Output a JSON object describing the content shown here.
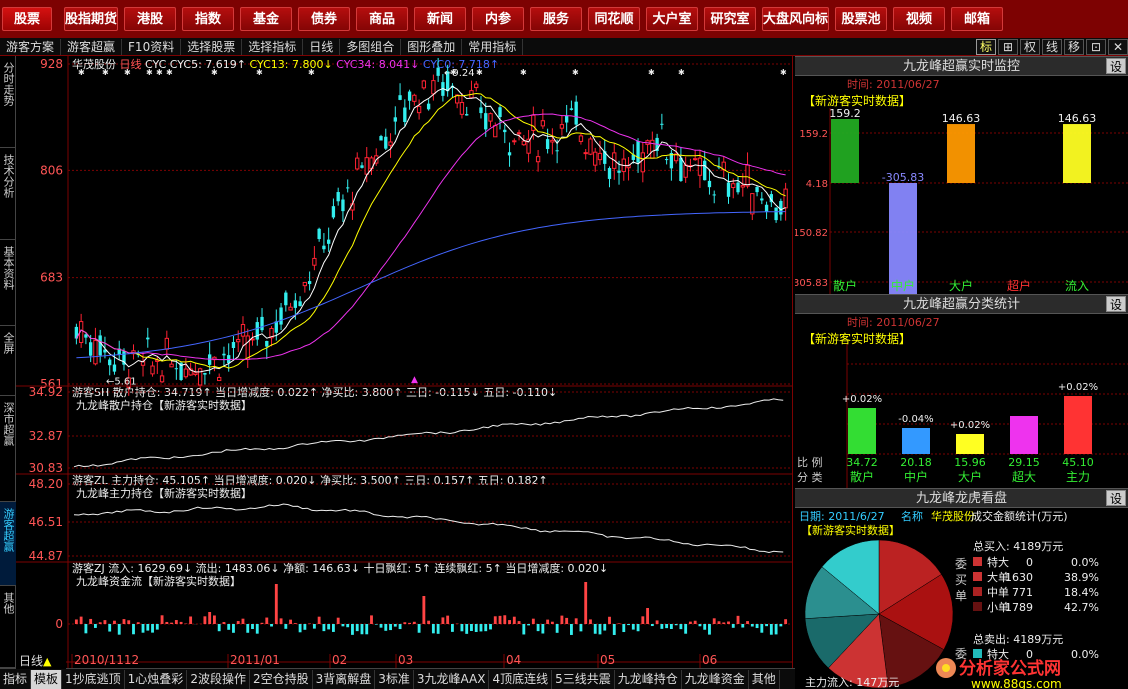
{
  "topmenu": [
    "股票",
    "股指期货",
    "港股",
    "指数",
    "基金",
    "债券",
    "商品",
    "新闻",
    "内参",
    "服务",
    "同花顺",
    "大户室",
    "研究室",
    "大盘风向标",
    "股票池",
    "视频",
    "邮箱"
  ],
  "toolbar": {
    "items": [
      "游客方案",
      "游客超赢",
      "F10资料",
      "选择股票",
      "选择指标",
      "日线",
      "多图组合",
      "图形叠加",
      "常用指标"
    ],
    "right_icons": [
      "标",
      "⊞",
      "权",
      "线",
      "移",
      "⊡",
      "✕"
    ]
  },
  "lefttabs": [
    "分时走势",
    "技术分析",
    "基本资料",
    "全屏",
    "深市超赢",
    "游客超赢",
    "其他"
  ],
  "bottombar": {
    "left_label": "日线",
    "tabs": [
      "指标",
      "模板",
      "1抄底逃顶",
      "1心烛叠彩",
      "2波段操作",
      "2空仓持股",
      "3背离解盘",
      "3标准",
      "3九龙峰AAX",
      "4顶底连线",
      "5三线共震",
      "九龙峰持仓",
      "九龙峰资金",
      "其他"
    ]
  },
  "main": {
    "stock": "华茂股份",
    "period": "日线",
    "indicator": "CYC",
    "cyc5": "CYC5: 7.619↑",
    "cyc13": "CYC13: 7.800↓",
    "cyc34": "CYC34: 8.041↓",
    "cyc0": "CYC0: 7.718↑",
    "high_label": "9.24",
    "low_label": "5.61",
    "y_ticks": [
      "928",
      "806",
      "683",
      "561"
    ],
    "date_labels": [
      "2010/1112",
      "2011/01",
      "02",
      "03",
      "04",
      "05",
      "06"
    ],
    "colors": {
      "up": "#f23",
      "down": "#3ee",
      "cyc5": "#fff",
      "cyc13": "#ff0",
      "cyc34": "#e3e",
      "cyc0": "#46f"
    }
  },
  "panel1": {
    "line1": "游客SH 散户持仓: 34.719↑ 当日增减度: 0.022↑ 净买比: 3.800↑ 三日: -0.115↓ 五日: -0.110↓",
    "line2": "九龙峰散户持仓【新游客实时数据】",
    "y_ticks": [
      "34.92",
      "32.87",
      "30.83"
    ]
  },
  "panel2": {
    "line1": "游客ZL 主力持仓: 45.105↑ 当日增减度: 0.020↓ 净买比: 3.500↑ 三日: 0.157↑ 五日: 0.182↑",
    "line2": "九龙峰主力持仓【新游客实时数据】",
    "y_ticks": [
      "48.20",
      "46.51",
      "44.87"
    ]
  },
  "panel3": {
    "line1": "游客ZJ 流入: 1629.69↓ 流出: 1483.06↓ 净额: 146.63↓ 十日飘红: 5↑ 连续飘红: 5↑ 当日增减度: 0.020↓",
    "line2": "九龙峰资金流【新游客实时数据】",
    "y_ticks": [
      "0"
    ]
  },
  "right1": {
    "title": "九龙峰超赢实时监控",
    "set": "设",
    "time": "时间: 2011/06/27",
    "tag": "【新游客实时数据】",
    "y_ticks": [
      "159.2",
      "4.18",
      "150.82",
      "305.83"
    ],
    "bars": [
      {
        "label": "散户",
        "value": 159.2,
        "text": "159.2",
        "color": "#2a2"
      },
      {
        "label": "中户",
        "value": -305.83,
        "text": "-305.83",
        "color": "#88f"
      },
      {
        "label": "大户",
        "value": 146.63,
        "text": "146.63",
        "color": "#f90"
      },
      {
        "label": "超户",
        "value": 0,
        "text": "",
        "color": "#f33"
      },
      {
        "label": "流入",
        "value": 146.63,
        "text": "146.63",
        "color": "#ff2"
      }
    ]
  },
  "right2": {
    "title": "九龙峰超赢分类统计",
    "set": "设",
    "time": "时间: 2011/06/27",
    "tag": "【新游客实时数据】",
    "ratio_label": "比 例",
    "class_label": "分 类",
    "bars": [
      {
        "label": "散户",
        "pct": "+0.02%",
        "value": "34.72",
        "h": 0.02,
        "color": "#3d3"
      },
      {
        "label": "中户",
        "pct": "-0.04%",
        "value": "20.18",
        "h": -0.04,
        "color": "#39f"
      },
      {
        "label": "大户",
        "pct": "+0.02%",
        "value": "15.96",
        "h": 0.02,
        "color": "#ff2"
      },
      {
        "label": "超大",
        "pct": "",
        "value": "29.15",
        "h": 0,
        "color": "#e3e"
      },
      {
        "label": "主力",
        "pct": "+0.02%",
        "value": "45.10",
        "h": 0.02,
        "color": "#f33"
      }
    ]
  },
  "right3": {
    "title": "九龙峰龙虎看盘",
    "set": "设",
    "date": "日期: 2011/6/27",
    "name_label": "名称",
    "name": "华茂股份",
    "subtitle": "成交金额统计(万元)",
    "tag": "【新游客实时数据】",
    "buy_total": "总买入: 4189万元",
    "sell_total": "总卖出: 4189万元",
    "side_buy": "委买单",
    "side_sell": "委",
    "rows": [
      {
        "name": "特大",
        "amt": "0",
        "pct": "0.0%",
        "color": "#c33"
      },
      {
        "name": "大单",
        "amt": "1630",
        "pct": "38.9%",
        "color": "#c33"
      },
      {
        "name": "中单",
        "amt": "771",
        "pct": "18.4%",
        "color": "#a22"
      },
      {
        "name": "小单",
        "amt": "1789",
        "pct": "42.7%",
        "color": "#611"
      }
    ],
    "sell_rows": [
      {
        "name": "特大",
        "amt": "0",
        "pct": "0.0%",
        "color": "#2bb"
      }
    ],
    "pie": [
      0.389,
      0.184,
      0.427,
      0.31,
      0.2
    ],
    "main_inflow": "主力流入: 147万元",
    "watermark": "分析家公式网",
    "watermark_url": "www.88gs.com"
  }
}
